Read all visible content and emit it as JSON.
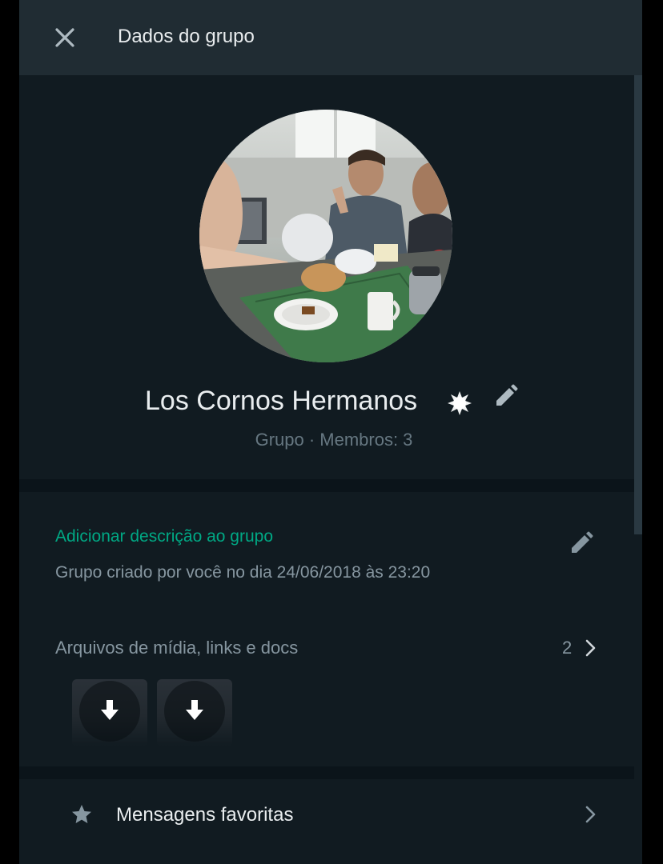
{
  "header": {
    "title": "Dados do grupo",
    "close_icon": "close-icon"
  },
  "profile": {
    "group_name": "Los Cornos Hermanos",
    "subtitle": "Grupo · Membros: 3",
    "name_badge_icon": "burst-icon",
    "edit_icon": "pencil-icon"
  },
  "info": {
    "add_description": "Adicionar descrição ao grupo",
    "created": "Grupo criado por você no dia 24/06/2018 às 23:20",
    "media_label": "Arquivos de mídia, links e docs",
    "media_count": "2",
    "thumbnails": [
      {
        "icon": "download-icon"
      },
      {
        "icon": "download-icon"
      }
    ]
  },
  "favorites": {
    "label": "Mensagens favoritas",
    "icon": "star-icon"
  },
  "colors": {
    "accent": "#00a884",
    "header_bg": "#202c33",
    "panel_bg": "#111b21",
    "divider_bg": "#0b141a",
    "primary_text": "#e9edef",
    "secondary_text": "#8696a0"
  }
}
